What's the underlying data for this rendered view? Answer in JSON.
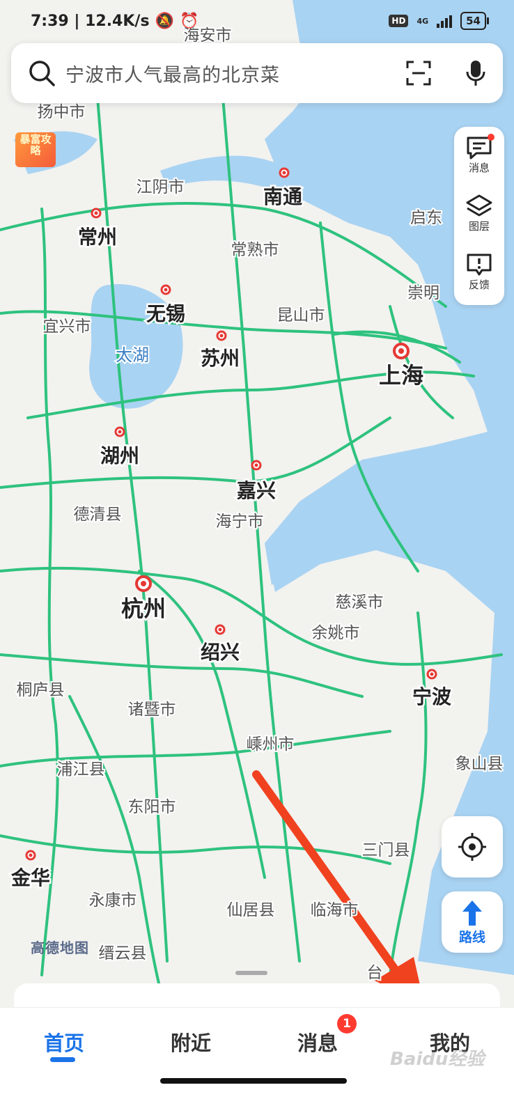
{
  "status_bar": {
    "time_speed": "7:39 | 12.4K/s",
    "hd": "HD",
    "network": "4G",
    "battery": "54"
  },
  "search": {
    "placeholder": "宁波市人气最高的北京菜",
    "scan_icon": "scan-icon",
    "mic_icon": "mic-icon"
  },
  "promo": {
    "text": "暴富攻略"
  },
  "tools": [
    {
      "label": "消息",
      "icon": "message-icon",
      "has_dot": true
    },
    {
      "label": "图层",
      "icon": "layers-icon"
    },
    {
      "label": "反馈",
      "icon": "feedback-icon"
    }
  ],
  "route_button": {
    "label": "路线"
  },
  "map": {
    "attribution": "高德地图",
    "colors": {
      "land": "#f2f2ef",
      "water": "#a9d3f2",
      "road": "#2ec27e",
      "city_marker": "#e53935",
      "label": "#222222",
      "sub_label": "#555555"
    },
    "cities": [
      {
        "name": "南通",
        "major": true
      },
      {
        "name": "常州",
        "major": true
      },
      {
        "name": "无锡",
        "major": true
      },
      {
        "name": "苏州",
        "major": true
      },
      {
        "name": "上海",
        "major": true
      },
      {
        "name": "湖州",
        "major": true
      },
      {
        "name": "嘉兴",
        "major": true
      },
      {
        "name": "杭州",
        "major": true
      },
      {
        "name": "绍兴",
        "major": true
      },
      {
        "name": "宁波",
        "major": true
      },
      {
        "name": "金华",
        "major": true
      }
    ],
    "towns": [
      "扬中市",
      "江阴市",
      "常熟市",
      "启东",
      "崇明",
      "宜兴市",
      "昆山市",
      "太湖",
      "德清县",
      "海宁市",
      "慈溪市",
      "余姚市",
      "桐庐县",
      "诸暨市",
      "嵊州市",
      "浦江县",
      "东阳市",
      "三门县",
      "象山县",
      "永康市",
      "仙居县",
      "临海市",
      "缙云县",
      "海安市",
      "台"
    ]
  },
  "bottom_nav": {
    "items": [
      "首页",
      "附近",
      "消息",
      "我的"
    ],
    "active": "首页",
    "badge": "1"
  },
  "watermark": "Baidu经验"
}
